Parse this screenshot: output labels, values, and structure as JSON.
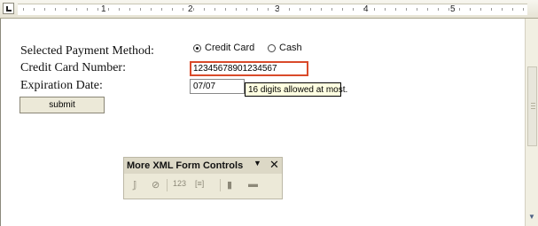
{
  "ruler": {
    "numbers": [
      "1",
      "2",
      "3",
      "4",
      "5"
    ]
  },
  "form": {
    "payment_label": "Selected Payment Method:",
    "radio_credit": "Credit Card",
    "radio_cash": "Cash",
    "card_label": "Credit Card Number:",
    "card_value": "123456789012345​67",
    "expiry_label": "Expiration Date:",
    "expiry_value": "07/07",
    "tooltip": "16 digits allowed at most.",
    "submit": "submit"
  },
  "toolbar": {
    "title": "More XML Form Controls",
    "dropdown_glyph": "▼",
    "close_glyph": "✕",
    "icons": [
      "𝕁",
      "⊘",
      "123",
      "[≡]",
      "▮",
      "▬"
    ]
  }
}
